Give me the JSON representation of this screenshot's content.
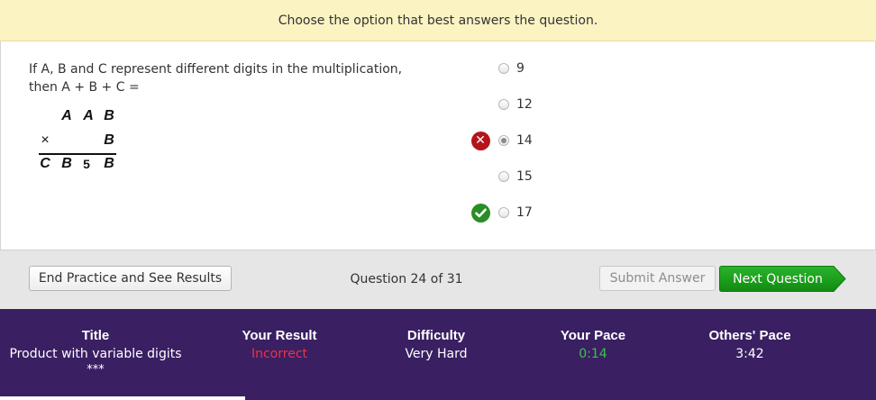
{
  "banner": {
    "text": "Choose the option that best answers the question."
  },
  "question": {
    "prompt_line1": "If A, B and C represent different digits in the multiplication,",
    "prompt_line2": "then A + B + C =",
    "multiplication": {
      "row1": [
        "A",
        "A",
        "B"
      ],
      "row2_operator": "×",
      "row2": [
        "B"
      ],
      "row3": [
        "C",
        "B",
        "5",
        "B"
      ]
    }
  },
  "options": [
    {
      "label": "9",
      "selected": false,
      "feedback": ""
    },
    {
      "label": "12",
      "selected": false,
      "feedback": ""
    },
    {
      "label": "14",
      "selected": true,
      "feedback": "wrong-icon"
    },
    {
      "label": "15",
      "selected": false,
      "feedback": ""
    },
    {
      "label": "17",
      "selected": false,
      "feedback": "check-icon"
    }
  ],
  "toolbar": {
    "end_label": "End Practice and See Results",
    "counter": "Question 24 of 31",
    "submit_label": "Submit Answer",
    "next_label": "Next Question"
  },
  "results": {
    "title_header": "Title",
    "title_value": "Product with variable digits",
    "stars": "***",
    "result_header": "Your Result",
    "result_value": "Incorrect",
    "difficulty_header": "Difficulty",
    "difficulty_value": "Very Hard",
    "pace_header": "Your Pace",
    "pace_value": "0:14",
    "others_header": "Others' Pace",
    "others_value": "3:42"
  },
  "colors": {
    "banner_bg": "#fcf3c3",
    "next_green": "#1a9a1a",
    "wrong_red": "#b3151b",
    "results_bg": "#3a1f62",
    "incorrect_text": "#e8344a",
    "pace_text": "#3fc24a"
  }
}
